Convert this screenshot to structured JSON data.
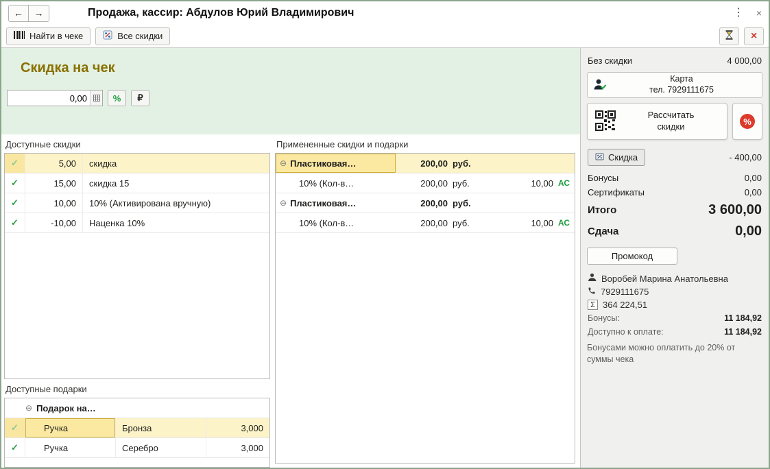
{
  "icons": {
    "back": "←",
    "forward": "→",
    "menu": "⋮",
    "close": "×",
    "check": "✓",
    "expander": "⊖",
    "sigma": "Σ",
    "percent_badge": "%"
  },
  "window": {
    "title": "Продажа, кассир: Абдулов Юрий Владимирович"
  },
  "toolbar": {
    "find_in_receipt": "Найти в чеке",
    "all_discounts": "Все скидки"
  },
  "discount_panel": {
    "heading": "Скидка на чек",
    "amount_value": "0,00",
    "percent_label": "%",
    "ruble_label": "₽"
  },
  "available_discounts": {
    "title": "Доступные скидки",
    "rows": [
      {
        "value": "5,00",
        "name": "скидка"
      },
      {
        "value": "15,00",
        "name": "скидка 15"
      },
      {
        "value": "10,00",
        "name": "10% (Активирована вручную)"
      },
      {
        "value": "-10,00",
        "name": "Наценка 10%"
      }
    ]
  },
  "applied": {
    "title": "Примененные скидки и подарки",
    "rows": [
      {
        "name": "Пластиковая…",
        "amount": "200,00",
        "currency": "руб.",
        "qty": "",
        "marker": ""
      },
      {
        "name": "10% (Кол-в…",
        "amount": "200,00",
        "currency": "руб.",
        "qty": "10,00",
        "marker": "АС"
      },
      {
        "name": "Пластиковая…",
        "amount": "200,00",
        "currency": "руб.",
        "qty": "",
        "marker": ""
      },
      {
        "name": "10% (Кол-в…",
        "amount": "200,00",
        "currency": "руб.",
        "qty": "10,00",
        "marker": "АС"
      }
    ]
  },
  "gifts": {
    "title": "Доступные подарки",
    "group": "Подарок на…",
    "rows": [
      {
        "name": "Ручка",
        "variant": "Бронза",
        "qty": "3,000"
      },
      {
        "name": "Ручка",
        "variant": "Серебро",
        "qty": "3,000"
      }
    ]
  },
  "summary": {
    "no_discount_label": "Без скидки",
    "no_discount_value": "4 000,00",
    "card_line1": "Карта",
    "card_line2": "тел. 7929111675",
    "calc_label": "Рассчитать скидки",
    "discount_button": "Скидка",
    "discount_value": "- 400,00",
    "bonuses_label": "Бонусы",
    "bonuses_value": "0,00",
    "certificates_label": "Сертификаты",
    "certificates_value": "0,00",
    "total_label": "Итого",
    "total_value": "3 600,00",
    "change_label": "Сдача",
    "change_value": "0,00",
    "promo_button": "Промокод",
    "customer_name": "Воробей Марина Анатольевна",
    "customer_phone": "7929111675",
    "customer_total": "364 224,51",
    "bonus_balance_label": "Бонусы:",
    "bonus_balance_value": "11 184,92",
    "available_pay_label": "Доступно к оплате:",
    "available_pay_value": "11 184,92",
    "note": "Бонусами можно оплатить до 20% от суммы чека"
  },
  "colors": {
    "accent_green": "#2f9e44",
    "highlight_row": "#fdf3c8",
    "panel_green": "#e2f1e3",
    "panel_gray": "#f0f0ee",
    "heading_gold": "#8a7000",
    "alert_red": "#d63b2f"
  }
}
